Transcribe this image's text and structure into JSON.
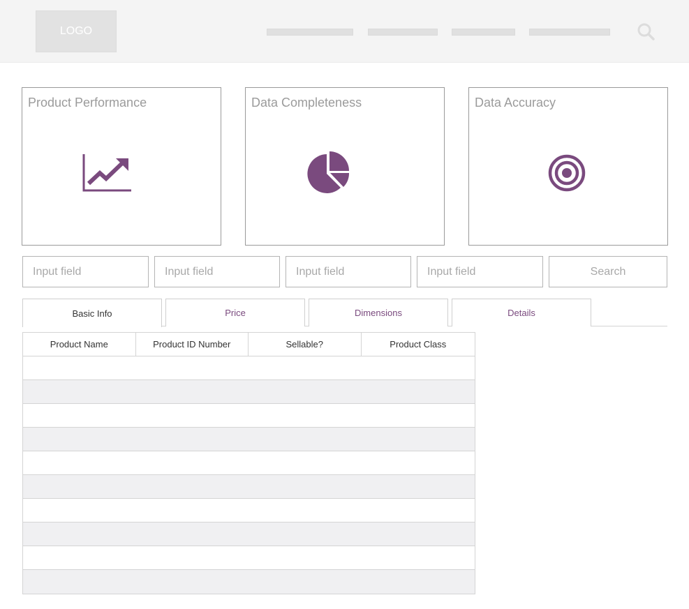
{
  "header": {
    "logo_label": "LOGO",
    "nav_items": [
      "",
      "",
      "",
      ""
    ],
    "search_icon": "search-icon"
  },
  "cards": [
    {
      "title": "Product Performance",
      "icon": "trending-up-chart-icon"
    },
    {
      "title": "Data Completeness",
      "icon": "pie-chart-icon"
    },
    {
      "title": "Data Accuracy",
      "icon": "target-icon"
    }
  ],
  "filters": {
    "inputs": [
      {
        "placeholder": "Input field"
      },
      {
        "placeholder": "Input field"
      },
      {
        "placeholder": "Input field"
      },
      {
        "placeholder": "Input field"
      }
    ],
    "search_label": "Search"
  },
  "tabs": [
    {
      "label": "Basic Info",
      "active": true
    },
    {
      "label": "Price",
      "active": false
    },
    {
      "label": "Dimensions",
      "active": false
    },
    {
      "label": "Details",
      "active": false
    }
  ],
  "table": {
    "columns": [
      "Product Name",
      "Product ID Number",
      "Sellable?",
      "Product Class"
    ],
    "rows": [
      [],
      [],
      [],
      [],
      [],
      [],
      [],
      [],
      [],
      []
    ]
  },
  "colors": {
    "accent": "#7a4a7e",
    "header_bg": "#f4f4f4",
    "row_stripe": "#f0f0f2"
  }
}
